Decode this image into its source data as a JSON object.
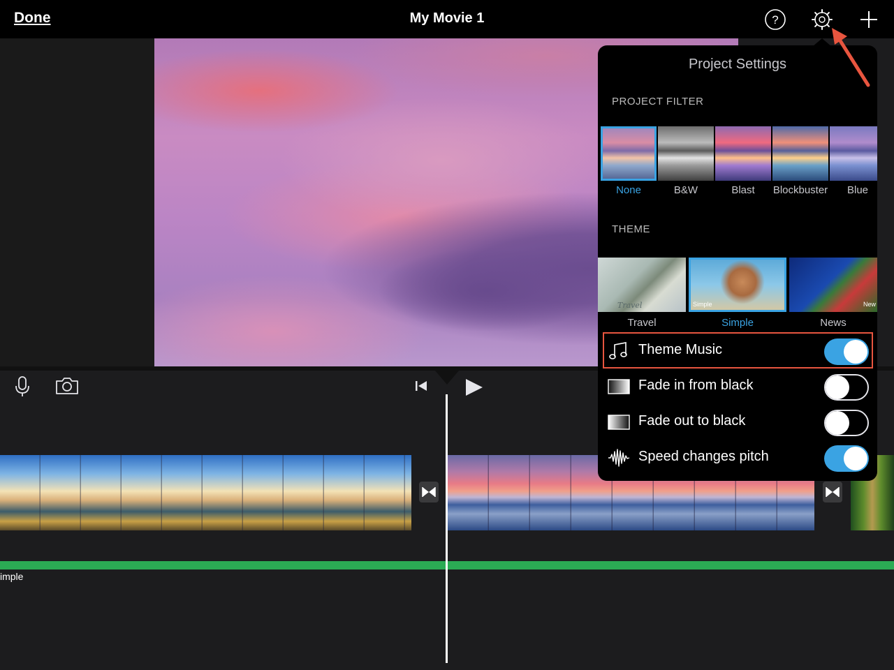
{
  "topbar": {
    "done_label": "Done",
    "title": "My Movie 1",
    "help_icon": "help-icon",
    "settings_icon": "gear-icon",
    "add_icon": "plus-icon"
  },
  "toolbar": {
    "mic_icon": "microphone-icon",
    "camera_icon": "camera-icon",
    "rewind_icon": "skip-to-start-icon",
    "play_icon": "play-icon"
  },
  "timeline": {
    "audio_track_label": "imple",
    "audio_color": "#2bab54",
    "transition_icon": "transition-icon"
  },
  "project_settings": {
    "title": "Project Settings",
    "filter_section": "PROJECT FILTER",
    "filters": [
      {
        "label": "None",
        "selected": true
      },
      {
        "label": "B&W",
        "selected": false
      },
      {
        "label": "Blast",
        "selected": false
      },
      {
        "label": "Blockbuster",
        "selected": false
      },
      {
        "label": "Blue",
        "selected": false
      }
    ],
    "theme_section": "THEME",
    "themes": [
      {
        "label": "Travel",
        "thumb_caption": "Travel",
        "selected": false
      },
      {
        "label": "Simple",
        "thumb_caption": "Simple",
        "selected": true
      },
      {
        "label": "News",
        "thumb_caption": "New",
        "selected": false
      }
    ],
    "options": [
      {
        "label": "Theme Music",
        "icon": "music-note-icon",
        "on": true
      },
      {
        "label": "Fade in from black",
        "icon": "fade-in-icon",
        "on": false
      },
      {
        "label": "Fade out to black",
        "icon": "fade-out-icon",
        "on": false
      },
      {
        "label": "Speed changes pitch",
        "icon": "waveform-icon",
        "on": true
      }
    ],
    "accent_color": "#3aa3e3",
    "highlight_color": "#e8553f"
  }
}
